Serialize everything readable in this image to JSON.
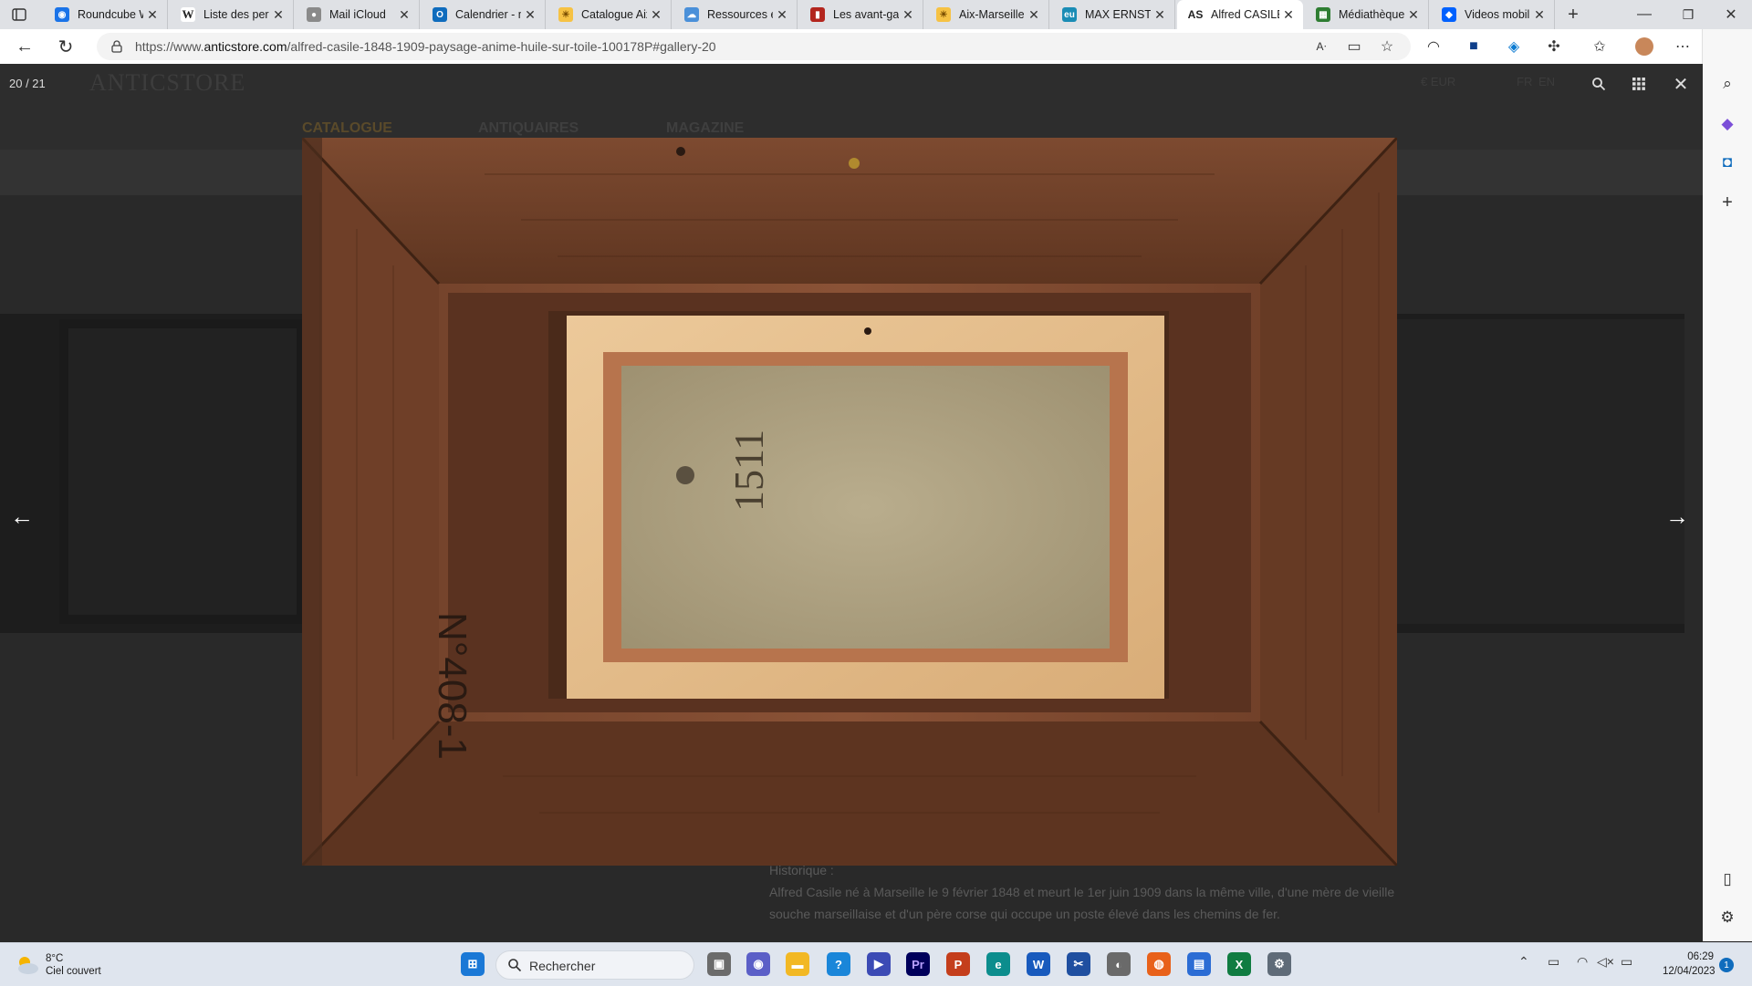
{
  "browser": {
    "tabs": [
      {
        "label": "Roundcube W",
        "favicon": "roundcube-icon",
        "color": "#1a73e8"
      },
      {
        "label": "Liste des pers",
        "favicon": "wikipedia-icon",
        "color": "#333333"
      },
      {
        "label": "Mail iCloud",
        "favicon": "apple-icon",
        "color": "#6d6d6d"
      },
      {
        "label": "Calendrier - m",
        "favicon": "outlook-icon",
        "color": "#0f6cbd"
      },
      {
        "label": "Catalogue Aix",
        "favicon": "sun-icon",
        "color": "#e8a317"
      },
      {
        "label": "Ressources él",
        "favicon": "cloud-icon",
        "color": "#4a90d9"
      },
      {
        "label": "Les avant-gar",
        "favicon": "book-icon",
        "color": "#b3261e"
      },
      {
        "label": "Aix-Marseille",
        "favicon": "sun-icon",
        "color": "#e8a317"
      },
      {
        "label": "MAX ERNST (",
        "favicon": "eu-icon",
        "color": "#1a8cb5"
      },
      {
        "label": "Alfred CASILE",
        "favicon": "anticstore-icon",
        "color": "#222222",
        "active": true
      },
      {
        "label": "Médiathèque",
        "favicon": "library-icon",
        "color": "#2e7d32"
      },
      {
        "label": "Videos mobil",
        "favicon": "dropbox-icon",
        "color": "#0061fe"
      }
    ],
    "url_prefix": "https://www.",
    "url_domain": "anticstore.com",
    "url_path": "/alfred-casile-1848-1909-paysage-anime-huile-sur-toile-100178P#gallery-20"
  },
  "site": {
    "logo": "ANTICSTORE",
    "menu": [
      "CATALOGUE",
      "ANTIQUAIRES",
      "MAGAZINE"
    ],
    "currency": "€ EUR",
    "langs": [
      "FR",
      "EN"
    ],
    "article_heading": "Historique :",
    "article_text": "Alfred Casile né à Marseille le 9 février 1848 et meurt le 1er juin 1909 dans la même ville, d'une mère de vieille souche marseillaise et d'un père corse qui occupe un poste élevé dans les chemins de fer."
  },
  "gallery": {
    "counter": "20 / 21",
    "photo_inscription": "N°408-1",
    "photo_stamp": "1511"
  },
  "taskbar": {
    "temperature": "8°C",
    "condition": "Ciel couvert",
    "search_label": "Rechercher",
    "time": "06:29",
    "date": "12/04/2023",
    "notification_count": "1"
  }
}
